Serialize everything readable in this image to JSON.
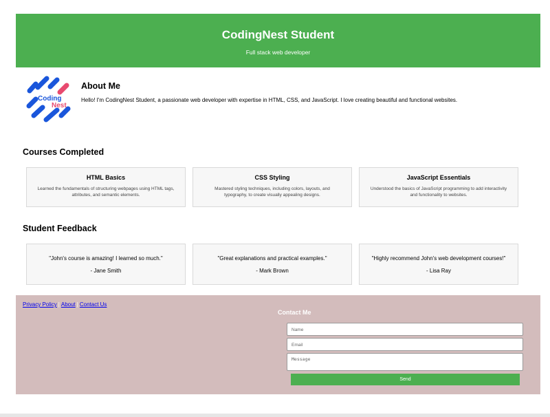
{
  "header": {
    "title": "CodingNest Student",
    "subtitle": "Full stack web developer"
  },
  "logo": {
    "text_top": "Coding",
    "text_bottom": "Nest",
    "colors": {
      "blue": "#1a56db",
      "pink": "#e84a6f"
    }
  },
  "about": {
    "heading": "About Me",
    "text": "Hello! I'm CodingNest Student, a passionate web developer with expertise in HTML, CSS, and JavaScript. I love creating beautiful and functional websites."
  },
  "courses": {
    "heading": "Courses Completed",
    "items": [
      {
        "title": "HTML Basics",
        "desc": "Learned the fundamentals of structuring webpages using HTML tags, attributes, and semantic elements."
      },
      {
        "title": "CSS Styling",
        "desc": "Mastered styling techniques, including colors, layouts, and typography, to create visually appealing designs."
      },
      {
        "title": "JavaScript Essentials",
        "desc": "Understood the basics of JavaScript programming to add interactivity and functionality to websites."
      }
    ]
  },
  "feedback": {
    "heading": "Student Feedback",
    "items": [
      {
        "quote": "\"John's course is amazing! I learned so much.\"",
        "author": "- Jane Smith"
      },
      {
        "quote": "\"Great explanations and practical examples.\"",
        "author": "- Mark Brown"
      },
      {
        "quote": "\"Highly recommend John's web development courses!\"",
        "author": "- Lisa Ray"
      }
    ]
  },
  "footer": {
    "links": [
      "Privacy Policy",
      "About",
      "Contact Us"
    ],
    "separator": "|",
    "contact_title": "Contact Me",
    "form": {
      "name_placeholder": "Name",
      "email_placeholder": "Email",
      "message_placeholder": "Message",
      "send_label": "Send"
    }
  },
  "colors": {
    "header_bg": "#4caf50",
    "footer_bg": "#d3bcbc",
    "button_bg": "#4caf50"
  }
}
